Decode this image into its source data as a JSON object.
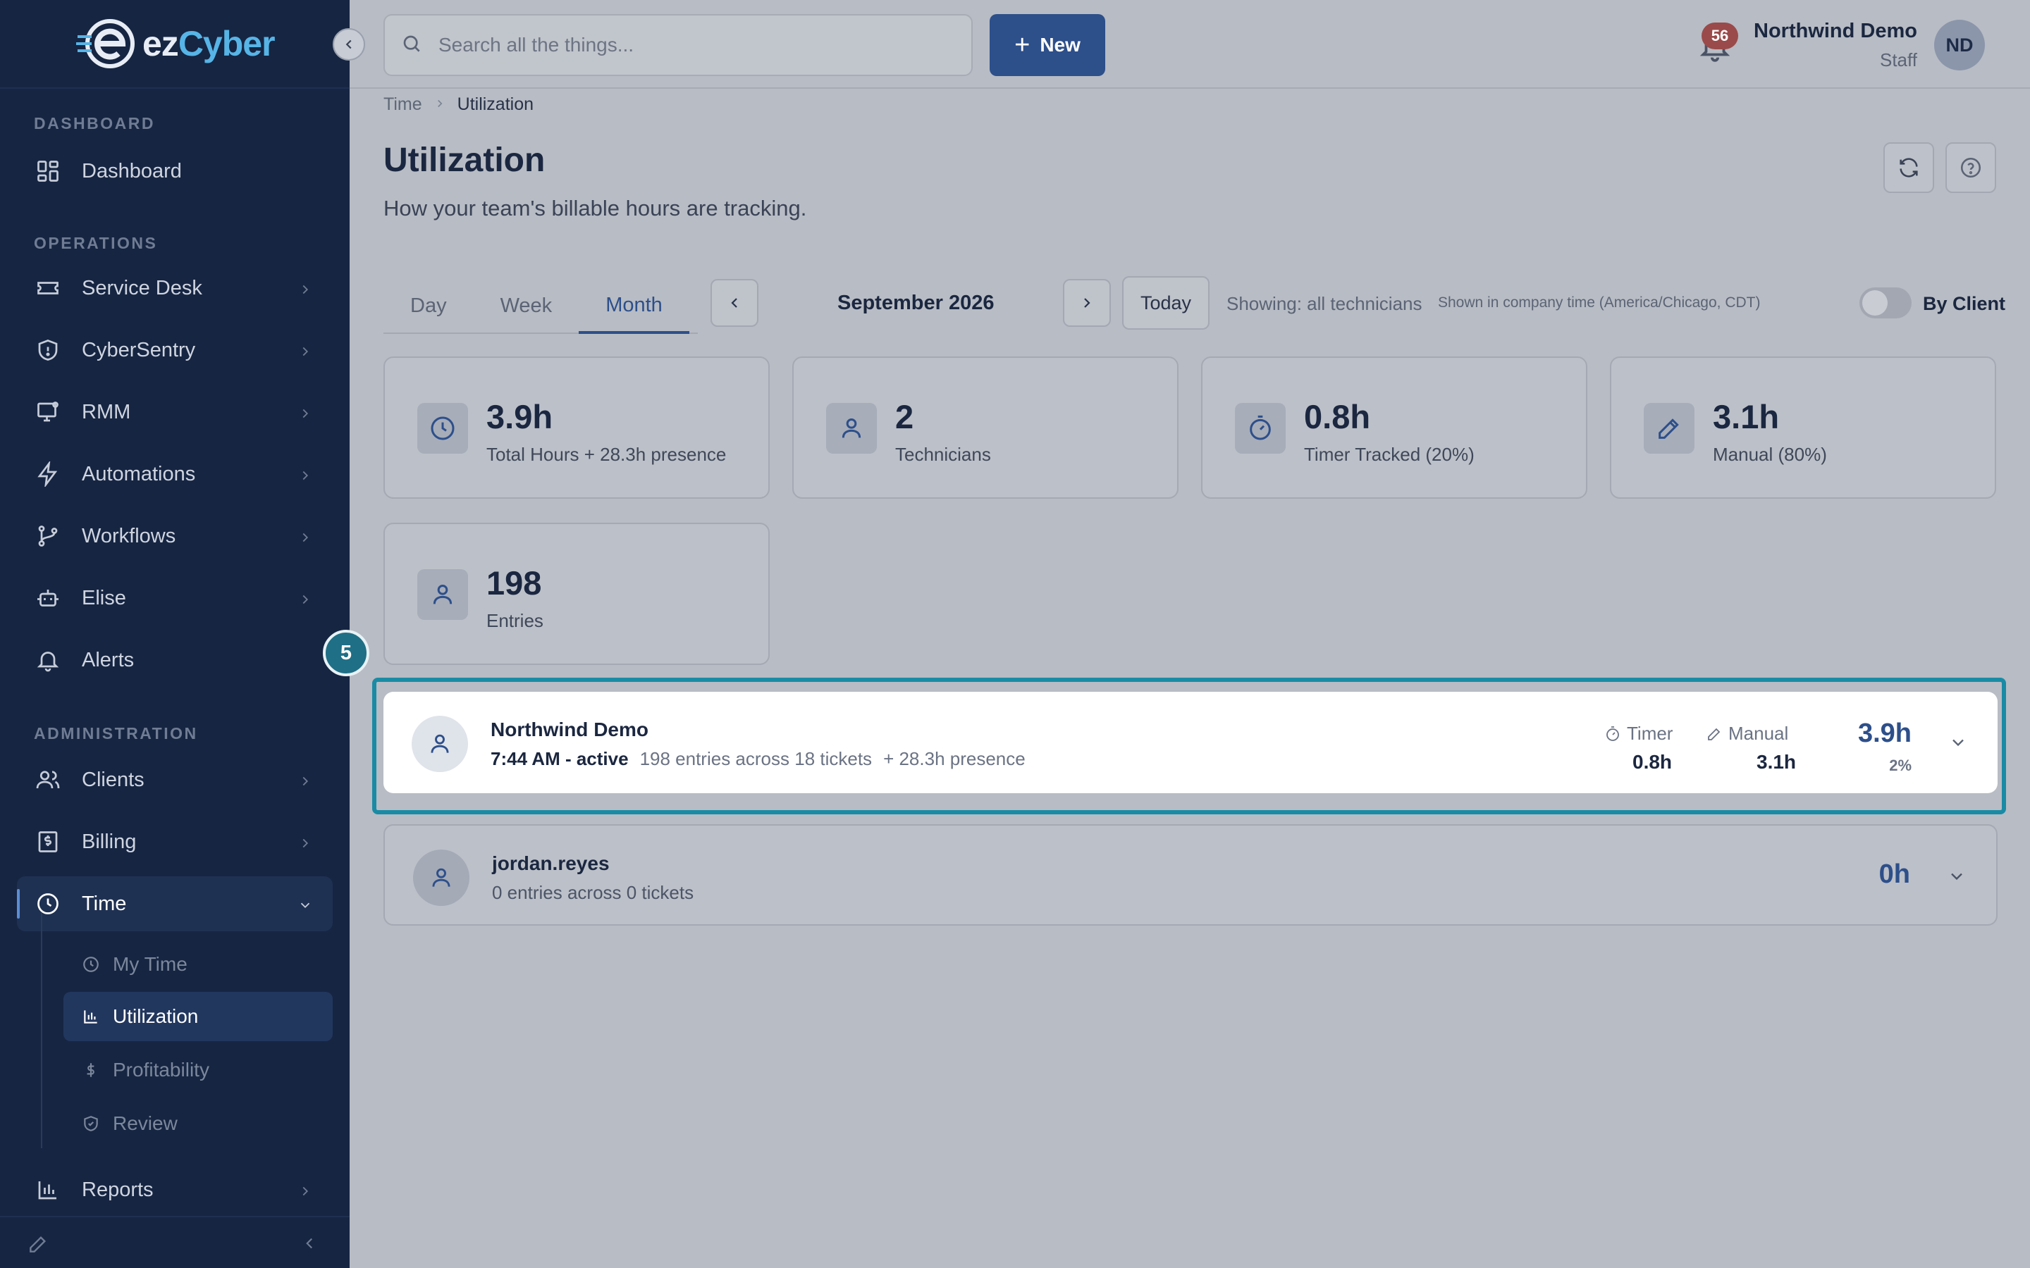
{
  "brand": {
    "logo_text_dark": "ez",
    "logo_text_accent": "Cyber"
  },
  "sidebar": {
    "sections": [
      {
        "label": "DASHBOARD"
      },
      {
        "label": "OPERATIONS"
      },
      {
        "label": "ADMINISTRATION"
      }
    ],
    "items": [
      {
        "label": "Dashboard",
        "icon": "grid-icon"
      },
      {
        "label": "Service Desk",
        "icon": "ticket-icon"
      },
      {
        "label": "CyberSentry",
        "icon": "shield-icon"
      },
      {
        "label": "RMM",
        "icon": "monitor-icon"
      },
      {
        "label": "Automations",
        "icon": "bolt-icon"
      },
      {
        "label": "Workflows",
        "icon": "branch-icon"
      },
      {
        "label": "Elise",
        "icon": "bot-icon"
      },
      {
        "label": "Alerts",
        "icon": "bell-icon"
      },
      {
        "label": "Clients",
        "icon": "users-icon"
      },
      {
        "label": "Billing",
        "icon": "receipt-icon"
      },
      {
        "label": "Time",
        "icon": "clock-icon"
      },
      {
        "label": "Reports",
        "icon": "bar-chart-icon"
      }
    ],
    "time_sub": [
      {
        "label": "My Time"
      },
      {
        "label": "Utilization"
      },
      {
        "label": "Profitability"
      },
      {
        "label": "Review"
      }
    ]
  },
  "topbar": {
    "search_placeholder": "Search all the things...",
    "new_label": "New",
    "notification_count": "56",
    "user_name": "Northwind Demo",
    "user_role": "Staff",
    "avatar_initials": "ND"
  },
  "breadcrumb": {
    "parent": "Time",
    "current": "Utilization"
  },
  "page": {
    "title": "Utilization",
    "subtitle": "How your team's billable hours are tracking."
  },
  "controls": {
    "tabs": [
      "Day",
      "Week",
      "Month"
    ],
    "active_tab": "Month",
    "period": "September 2026",
    "today_label": "Today",
    "showing": "Showing: all technicians",
    "tz_note": "Shown in company time (America/Chicago, CDT)",
    "toggle_label": "By Client"
  },
  "stats": [
    {
      "value": "3.9h",
      "label": "Total Hours + 28.3h presence",
      "icon": "clock-icon"
    },
    {
      "value": "2",
      "label": "Technicians",
      "icon": "user-icon"
    },
    {
      "value": "0.8h",
      "label": "Timer Tracked (20%)",
      "icon": "stopwatch-icon"
    },
    {
      "value": "3.1h",
      "label": "Manual (80%)",
      "icon": "pencil-icon"
    },
    {
      "value": "198",
      "label": "Entries",
      "icon": "user-icon"
    }
  ],
  "step_badge": "5",
  "rows": [
    {
      "name": "Northwind Demo",
      "status": "7:44 AM - active",
      "entries": "198 entries across 18 tickets",
      "presence": "+ 28.3h presence",
      "timer_label": "Timer",
      "timer_value": "0.8h",
      "manual_label": "Manual",
      "manual_value": "3.1h",
      "total": "3.9h",
      "pct": "2%"
    },
    {
      "name": "jordan.reyes",
      "entries": "0 entries across 0 tickets",
      "total": "0h"
    }
  ],
  "colors": {
    "sidebar_bg": "#162542",
    "accent": "#2d4f8a",
    "highlight": "#1a8ba5",
    "badge": "#9a4a4a"
  }
}
